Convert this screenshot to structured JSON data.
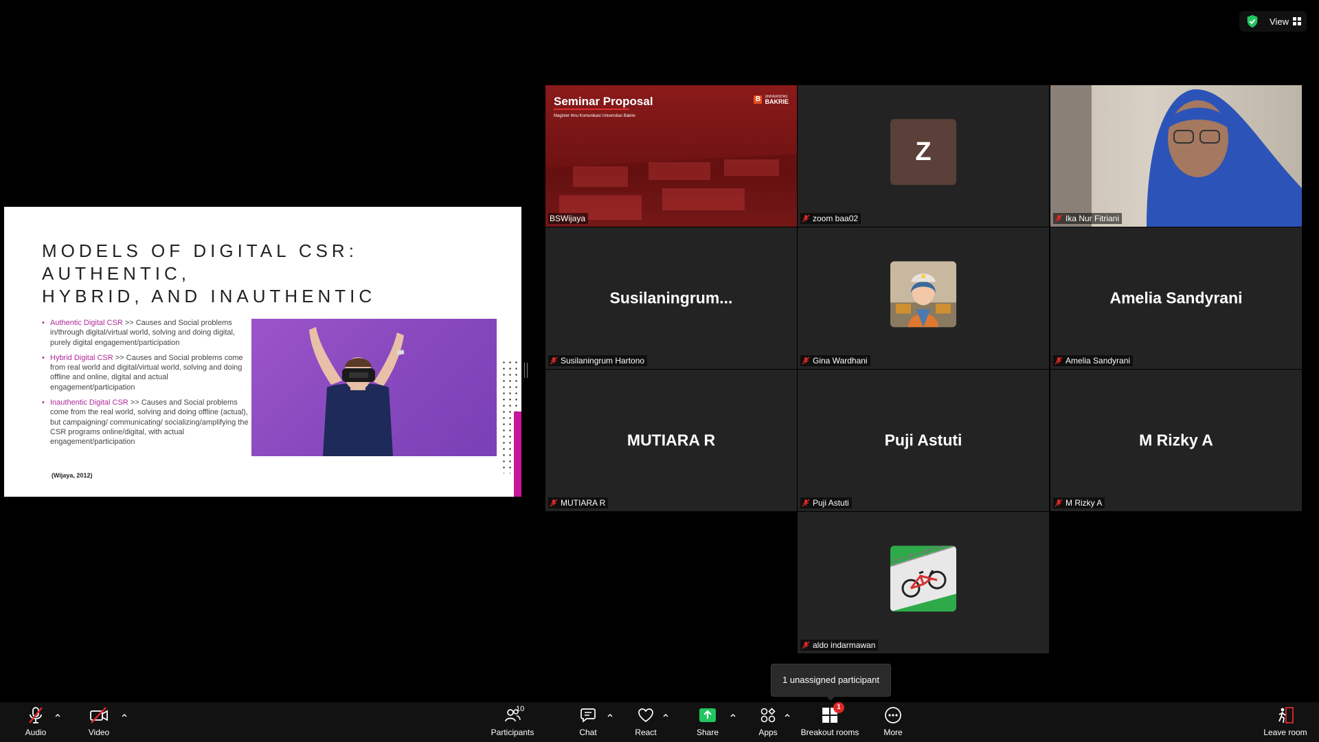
{
  "top": {
    "view_label": "View"
  },
  "slide": {
    "title_line1": "MODELS OF DIGITAL CSR: AUTHENTIC,",
    "title_line2": "HYBRID, AND INAUTHENTIC",
    "bullets": [
      {
        "term": "Authentic Digital CSR",
        "text": " >> Causes and Social problems in/through digital/virtual world, solving and doing digital, purely digital engagement/participation"
      },
      {
        "term": "Hybrid Digital CSR",
        "text": " >> Causes and Social problems come from real world and digital/virtual world, solving and doing offline and online, digital and actual engagement/participation"
      },
      {
        "term": "Inauthentic Digital CSR",
        "text": " >> Causes and Social problems come from the real world, solving and doing offline (actual), but campaigning/ communicating/ socializing/amplifying the CSR programs online/digital, with actual engagement/participation"
      }
    ],
    "citation": "(Wijaya, 2012)"
  },
  "participants": {
    "bswijaya": {
      "name": "BSWijaya",
      "bg_title": "Seminar Proposal",
      "bg_subtitle": "Magister Ilmu Komunikasi Universitas Bakrie",
      "bg_logo_small": "UNIVERSITAS",
      "bg_logo_big": "BAKRIE"
    },
    "zoom_baa02": {
      "name": "zoom baa02",
      "initial": "Z"
    },
    "ika": {
      "name": "Ika Nur Fitriani"
    },
    "susi": {
      "name": "Susilaningrum Hartono",
      "display": "Susilaningrum..."
    },
    "gina": {
      "name": "Gina Wardhani"
    },
    "amelia": {
      "name": "Amelia Sandyrani",
      "display": "Amelia Sandyrani"
    },
    "mutiara": {
      "name": "MUTIARA R",
      "display": "MUTIARA R"
    },
    "puji": {
      "name": "Puji Astuti",
      "display": "Puji Astuti"
    },
    "rizky": {
      "name": "M Rizky A",
      "display": "M Rizky A"
    },
    "aldo": {
      "name": "aldo indarmawan"
    }
  },
  "tooltip": {
    "text": "1 unassigned participant"
  },
  "toolbar": {
    "audio": "Audio",
    "video": "Video",
    "participants": "Participants",
    "participants_count": "10",
    "chat": "Chat",
    "react": "React",
    "share": "Share",
    "apps": "Apps",
    "breakout": "Breakout rooms",
    "breakout_badge": "1",
    "more": "More",
    "leave": "Leave room"
  },
  "colors": {
    "accent_green": "#2cd07a",
    "slide_magenta": "#b0289a",
    "mic_off_red": "#e02828",
    "share_green": "#22c55e"
  }
}
